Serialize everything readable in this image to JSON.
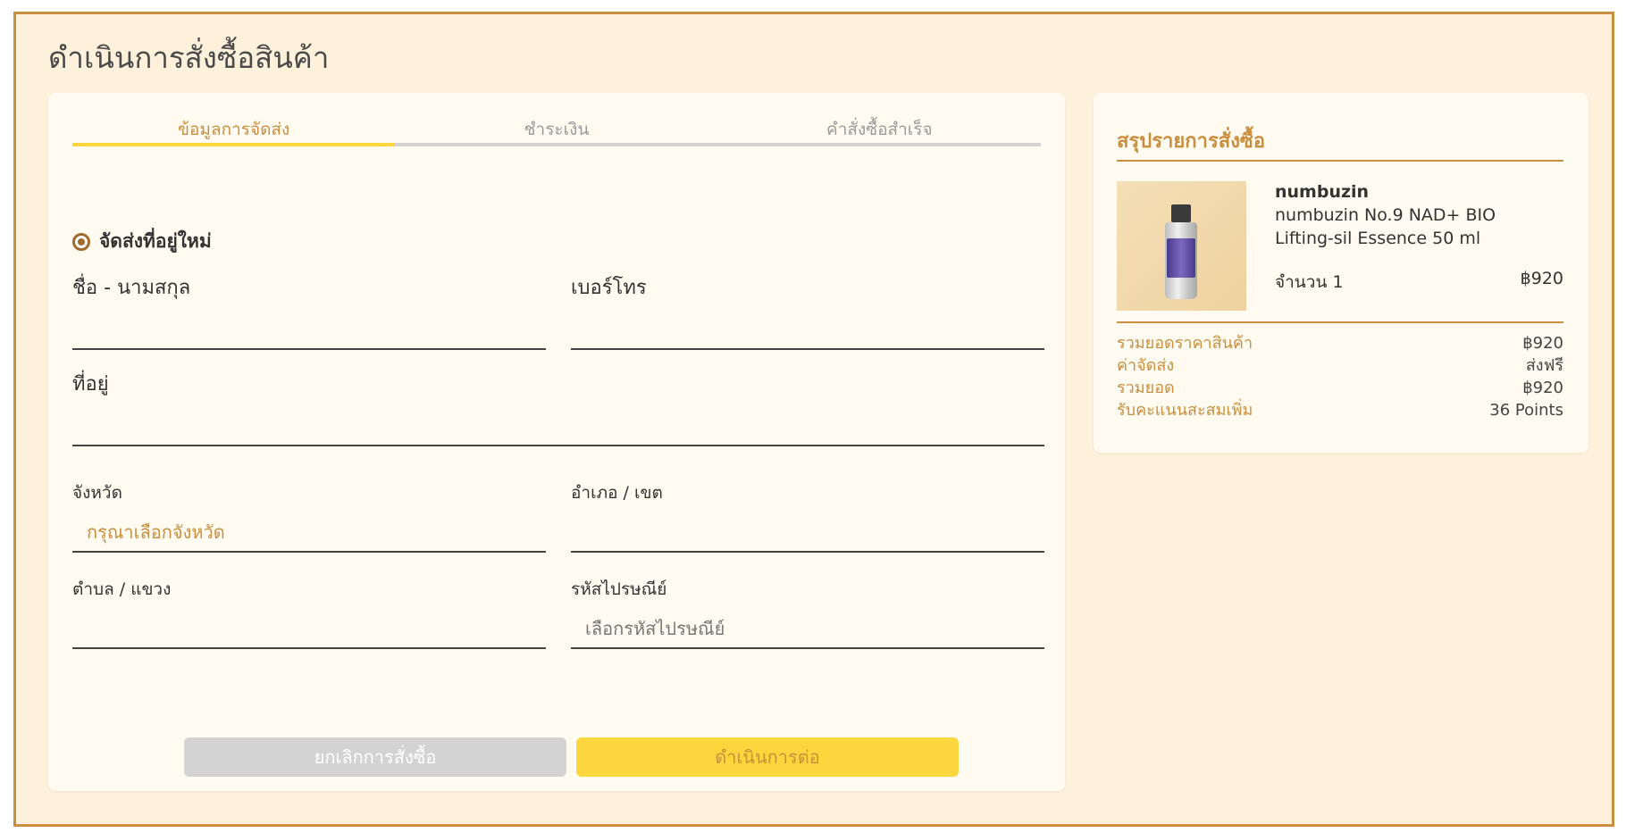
{
  "page": {
    "title": "ดำเนินการสั่งซื้อสินค้า"
  },
  "steps": [
    {
      "label": "ข้อมูลการจัดส่ง",
      "active": true
    },
    {
      "label": "ชำระเงิน",
      "active": false
    },
    {
      "label": "คำสั่งซื้อสำเร็จ",
      "active": false
    }
  ],
  "form": {
    "radio_label": "จัดส่งที่อยู่ใหม่",
    "name_label": "ชื่อ - นามสกุล",
    "phone_label": "เบอร์โทร",
    "address_label": "ที่อยู่",
    "province_label": "จังหวัด",
    "province_placeholder": "กรุณาเลือกจังหวัด",
    "district_label": "อำเภอ / เขต",
    "subdistrict_label": "ตำบล / แขวง",
    "postcode_label": "รหัสไปรษณีย์",
    "postcode_placeholder": "เลือกรหัสไปรษณีย์",
    "cancel_label": "ยกเลิกการสั่งซื้อ",
    "next_label": "ดำเนินการต่อ"
  },
  "summary": {
    "title": "สรุปรายการสั่งซื้อ",
    "product": {
      "brand": "numbuzin",
      "name": "numbuzin No.9 NAD+ BIO Lifting-sil Essence 50 ml",
      "quantity": "จำนวน 1",
      "price": "฿920"
    },
    "totals": [
      {
        "label": "รวมยอดราคาสินค้า",
        "value": "฿920"
      },
      {
        "label": "ค่าจัดส่ง",
        "value": "ส่งฟรี"
      },
      {
        "label": "รวมยอด",
        "value": "฿920"
      },
      {
        "label": "รับคะแนนสะสมเพิ่ม",
        "value": "36 Points"
      }
    ]
  },
  "colors": {
    "accent": "#c98f3e",
    "yellow": "#fcd63d",
    "background": "#fdf1db",
    "card": "#fffbf1",
    "disabled": "#d3d3d3"
  }
}
